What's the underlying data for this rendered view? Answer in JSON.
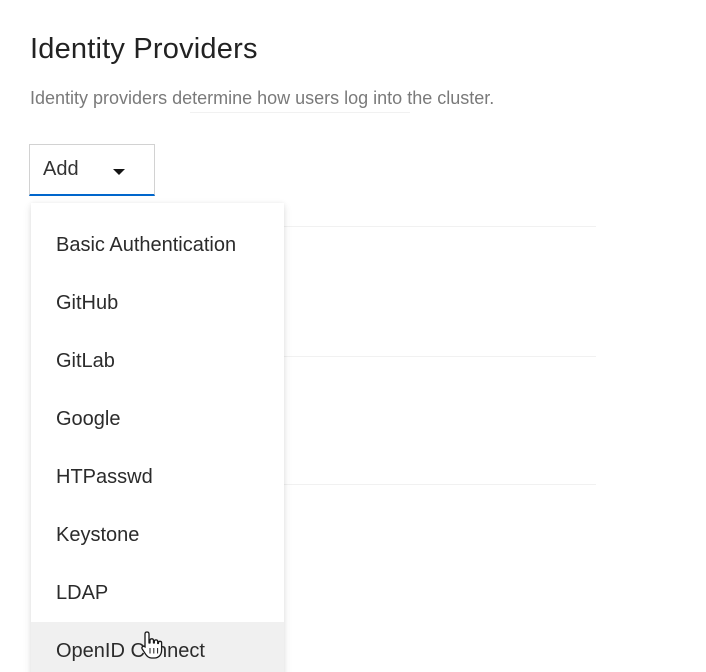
{
  "header": {
    "title": "Identity Providers",
    "description": "Identity providers determine how users log into the cluster."
  },
  "add_dropdown": {
    "label": "Add",
    "caret_icon": "caret-down-icon",
    "underline_color": "#0066cc",
    "expanded": true,
    "items": [
      {
        "label": "Basic Authentication"
      },
      {
        "label": "GitHub"
      },
      {
        "label": "GitLab"
      },
      {
        "label": "Google"
      },
      {
        "label": "HTPasswd"
      },
      {
        "label": "Keystone"
      },
      {
        "label": "LDAP"
      },
      {
        "label": "OpenID Connect",
        "hovered": true
      }
    ]
  },
  "cursor": {
    "icon": "hand-pointer-icon"
  }
}
